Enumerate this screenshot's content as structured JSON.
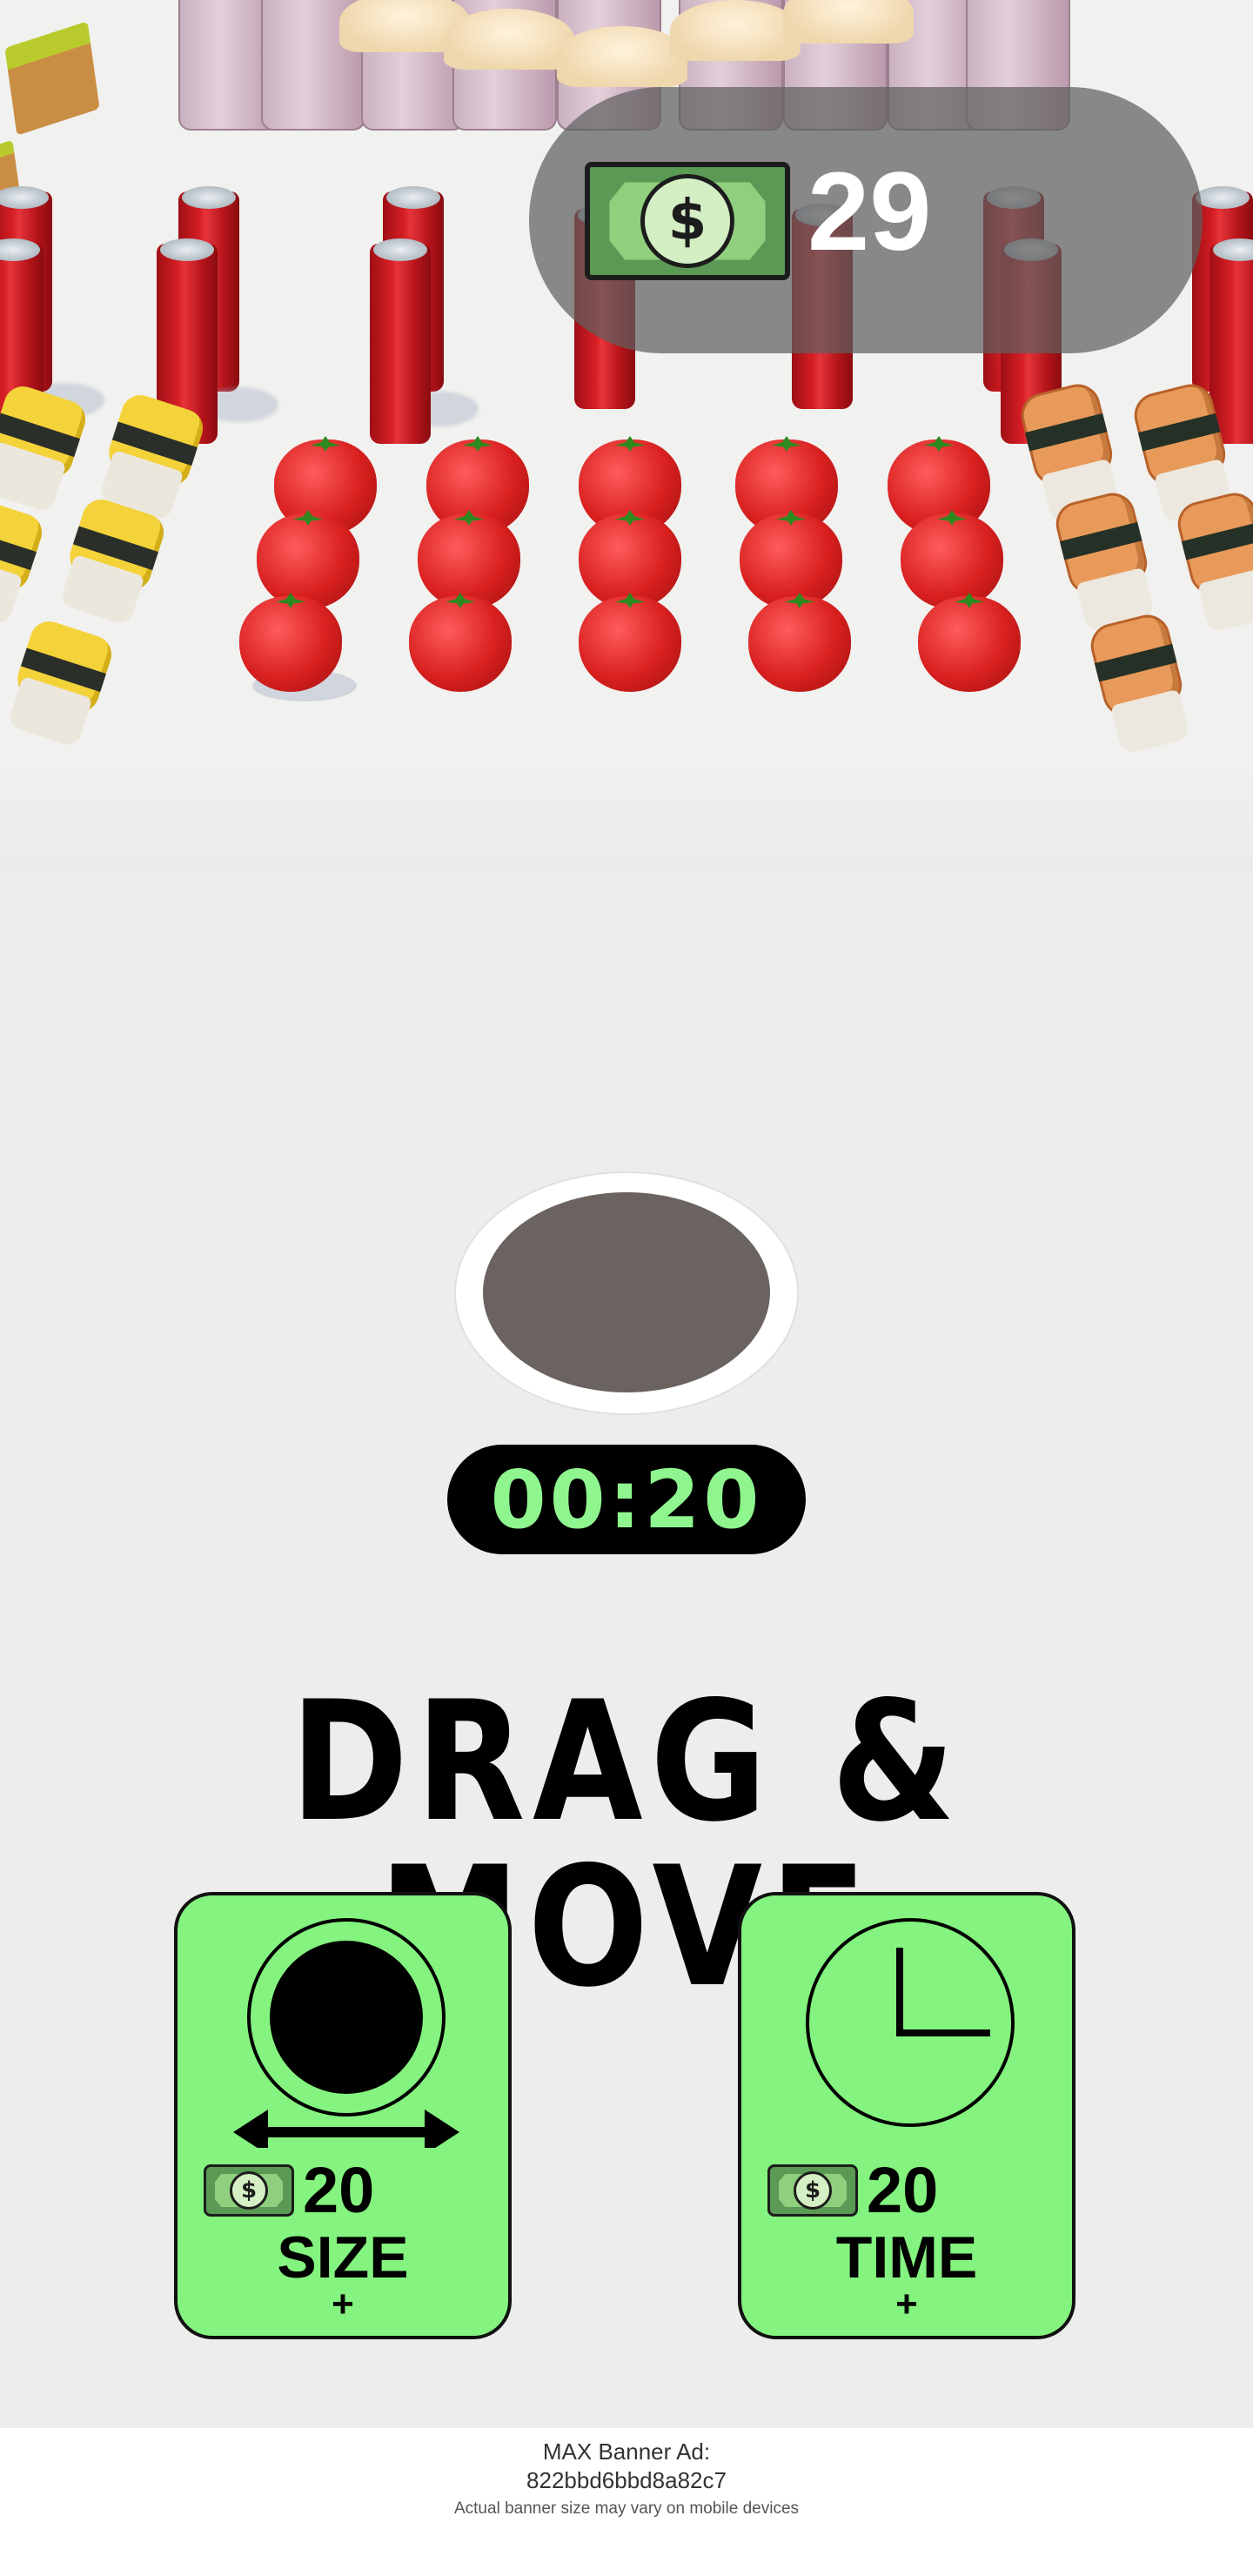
{
  "hud": {
    "money_icon": "dollar-bill-icon",
    "money": "29",
    "timer": "00:20"
  },
  "headline": "DRAG & MOVE",
  "upgrades": [
    {
      "icon": "hole-size-icon",
      "currency_icon": "dollar-bill-icon",
      "price": "20",
      "label": "SIZE",
      "plus": "+"
    },
    {
      "icon": "clock-icon",
      "currency_icon": "dollar-bill-icon",
      "price": "20",
      "label": "TIME",
      "plus": "+"
    }
  ],
  "banner": {
    "line1": "MAX Banner Ad:",
    "line2": "822bbd6bbd8a82c7",
    "line3": "Actual banner size may vary on mobile devices"
  },
  "colors": {
    "upgrade_card": "#84f37f",
    "timer_text": "#8ff58f",
    "hole": "#6a6360",
    "money_pill": "#5f5f5f"
  },
  "scene_objects": [
    "milkshake-cup",
    "soda-can",
    "tomato",
    "tamago-sushi",
    "salmon-sushi",
    "cake-slice"
  ]
}
